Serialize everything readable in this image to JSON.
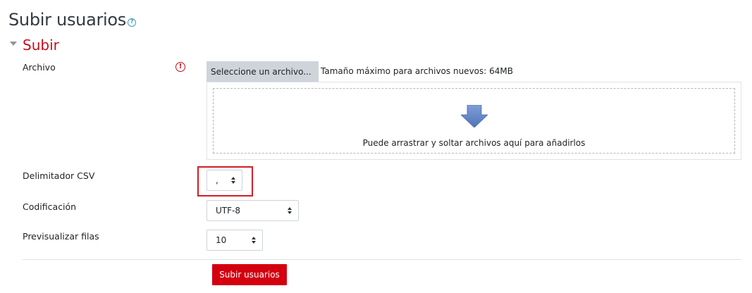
{
  "page": {
    "title": "Subir usuarios",
    "help_icon": "?"
  },
  "section": {
    "title": "Subir"
  },
  "file_field": {
    "label": "Archivo",
    "required_icon": "!",
    "button_label": "Seleccione un archivo...",
    "max_size_text": "Tamaño máximo para archivos nuevos: 64MB",
    "dropzone_text": "Puede arrastrar y soltar archivos aquí para añadirlos"
  },
  "delimiter_field": {
    "label": "Delimitador CSV",
    "value": ","
  },
  "encoding_field": {
    "label": "Codificación",
    "value": "UTF-8"
  },
  "preview_field": {
    "label": "Previsualizar filas",
    "value": "10"
  },
  "submit": {
    "label": "Subir usuarios"
  },
  "colors": {
    "accent": "#c80f1c",
    "button_primary": "#d4000f",
    "highlight_border": "#d21d26",
    "arrow": "#5a80c4"
  }
}
